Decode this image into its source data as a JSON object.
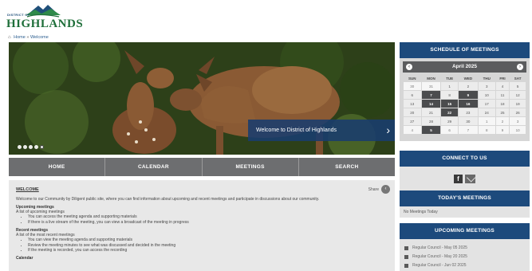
{
  "header": {
    "logo_small": "DISTRICT OF",
    "logo_name": "HIGHLANDS",
    "breadcrumb": {
      "home": "Home",
      "separator": "»",
      "current": "Welcome"
    }
  },
  "hero": {
    "caption": "Welcome to District of Highlands",
    "next_arrow": "›",
    "slides_total": 5,
    "active_slide": 5
  },
  "nav": {
    "items": [
      "HOME",
      "CALENDAR",
      "MEETINGS",
      "SEARCH"
    ]
  },
  "content": {
    "heading": "WELCOME",
    "share_label": "Share",
    "intro": "Welcome to our Community by Diligent public site, where you can find information about upcoming and recent meetings and participate in discussions about our community.",
    "upcoming_title": "Upcoming meetings",
    "upcoming_sub": "A list of upcoming meetings",
    "upcoming_bullets": [
      "You can access the meeting agenda and supporting materials",
      "If there is a live stream of the meeting, you can view a broadcast of the meeting in progress"
    ],
    "recent_title": "Recent meetings",
    "recent_sub": "A list of the most recent meetings",
    "recent_bullets": [
      "You can view the meeting agenda and supporting materials",
      "Review the meeting minutes to see what was discussed and decided in the meeting",
      "If the meeting is recorded, you can access the recording"
    ],
    "calendar_title": "Calendar"
  },
  "sidebar": {
    "schedule_title": "SCHEDULE OF MEETINGS",
    "calendar": {
      "month": "April 2025",
      "prev": "‹",
      "next": "›",
      "weekdays": [
        "SUN",
        "MON",
        "TUE",
        "WED",
        "THU",
        "FRI",
        "SAT"
      ],
      "weeks": [
        [
          {
            "d": "30",
            "c": "other"
          },
          {
            "d": "31",
            "c": "other"
          },
          {
            "d": "1"
          },
          {
            "d": "2"
          },
          {
            "d": "3"
          },
          {
            "d": "4"
          },
          {
            "d": "5"
          }
        ],
        [
          {
            "d": "6"
          },
          {
            "d": "7",
            "c": "meet"
          },
          {
            "d": "8"
          },
          {
            "d": "9",
            "c": "meet"
          },
          {
            "d": "10"
          },
          {
            "d": "11"
          },
          {
            "d": "12"
          }
        ],
        [
          {
            "d": "13"
          },
          {
            "d": "14",
            "c": "meet"
          },
          {
            "d": "15",
            "c": "meet"
          },
          {
            "d": "16",
            "c": "meet"
          },
          {
            "d": "17"
          },
          {
            "d": "18"
          },
          {
            "d": "19"
          }
        ],
        [
          {
            "d": "20"
          },
          {
            "d": "21"
          },
          {
            "d": "22",
            "c": "meet"
          },
          {
            "d": "23"
          },
          {
            "d": "24"
          },
          {
            "d": "25"
          },
          {
            "d": "26"
          }
        ],
        [
          {
            "d": "27"
          },
          {
            "d": "28"
          },
          {
            "d": "29"
          },
          {
            "d": "30"
          },
          {
            "d": "1",
            "c": "other"
          },
          {
            "d": "2",
            "c": "other"
          },
          {
            "d": "3",
            "c": "other"
          }
        ],
        [
          {
            "d": "4",
            "c": "other"
          },
          {
            "d": "5",
            "c": "meet"
          },
          {
            "d": "6",
            "c": "other"
          },
          {
            "d": "7",
            "c": "other"
          },
          {
            "d": "8",
            "c": "other"
          },
          {
            "d": "9",
            "c": "other"
          },
          {
            "d": "10",
            "c": "other"
          }
        ]
      ]
    },
    "connect_title": "CONNECT TO US",
    "facebook_glyph": "f",
    "today_title": "TODAY'S MEETINGS",
    "today_text": "No Meetings Today",
    "upcoming_title": "UPCOMING MEETINGS",
    "upcoming_items": [
      "Regular Council - May 05 2025",
      "Regular Council - May 20 2025",
      "Regular Council - Jun 02 2025"
    ]
  },
  "colors": {
    "brand_blue": "#1d4a7c",
    "nav_gray": "#6d6e70",
    "logo_green": "#1f6f3a"
  }
}
